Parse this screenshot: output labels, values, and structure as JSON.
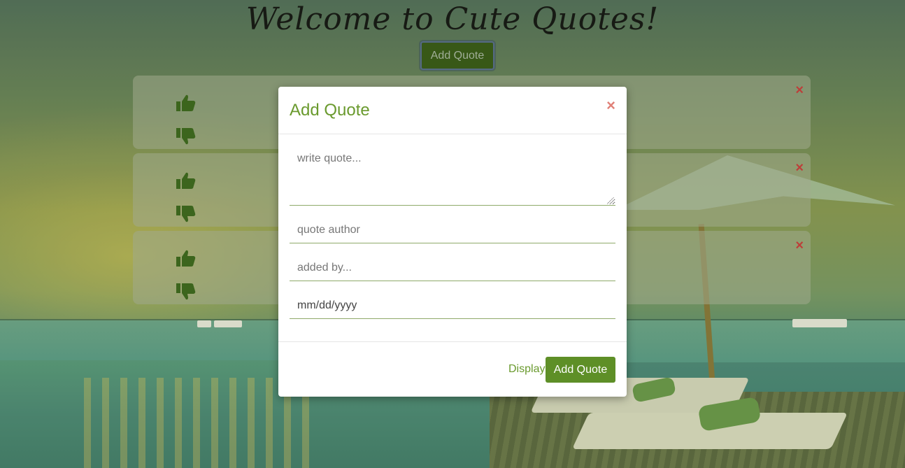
{
  "page": {
    "title": "Welcome to Cute Quotes!",
    "add_button_label": "Add Quote"
  },
  "quote_cards": [
    {
      "upvote_icon": "thumbs-up-icon",
      "downvote_icon": "thumbs-down-icon",
      "delete_label": "×"
    },
    {
      "upvote_icon": "thumbs-up-icon",
      "downvote_icon": "thumbs-down-icon",
      "delete_label": "×"
    },
    {
      "upvote_icon": "thumbs-up-icon",
      "downvote_icon": "thumbs-down-icon",
      "delete_label": "×"
    }
  ],
  "modal": {
    "title": "Add Quote",
    "close_label": "×",
    "fields": {
      "quote_placeholder": "write quote...",
      "author_placeholder": "quote author",
      "added_by_placeholder": "added by...",
      "date_placeholder": "mm/dd/yyyy"
    },
    "footer": {
      "display_label": "Display",
      "submit_label": "Add Quote"
    }
  },
  "colors": {
    "accent_green": "#5e8f27",
    "title_green": "#6a9a2e",
    "delete_red": "#c8403c",
    "thumb_green": "#3f6a1e"
  }
}
